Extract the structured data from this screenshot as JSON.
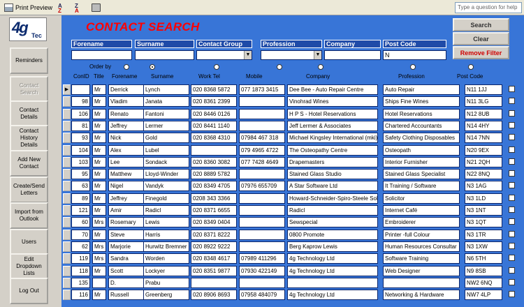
{
  "toolbar": {
    "print_preview": "Print Preview",
    "help_placeholder": "Type a question for help"
  },
  "logo": {
    "number": "4g",
    "text": "Tec"
  },
  "sidebar": [
    {
      "label": "Reminders",
      "disabled": false
    },
    {
      "label": "Contact Search",
      "disabled": true
    },
    {
      "label": "Contact Details",
      "disabled": false
    },
    {
      "label": "Contact History Details",
      "disabled": false
    },
    {
      "label": "Add New Contact",
      "disabled": false
    },
    {
      "label": "Create/Send Letters",
      "disabled": false
    },
    {
      "label": "Import from Outlook",
      "disabled": false
    },
    {
      "label": "Users",
      "disabled": false
    },
    {
      "label": "Edit Dropdown Lists",
      "disabled": false
    },
    {
      "label": "Log Out",
      "disabled": false
    }
  ],
  "title": "CONTACT SEARCH",
  "filters": {
    "forename": {
      "label": "Forename",
      "value": ""
    },
    "surname": {
      "label": "Surname",
      "value": ""
    },
    "contact_group": {
      "label": "Contact Group",
      "value": ""
    },
    "profession": {
      "label": "Profession",
      "value": ""
    },
    "company": {
      "label": "Company",
      "value": ""
    },
    "post_code": {
      "label": "Post Code",
      "value": "N"
    }
  },
  "actions": {
    "search": "Search",
    "clear": "Clear",
    "remove_filter": "Remove Filter"
  },
  "order_by": {
    "label": "Order by",
    "selected": "surname"
  },
  "columns": [
    "ConID",
    "Title",
    "Forename",
    "Surname",
    "Work Tel",
    "Mobile",
    "Company",
    "Profession",
    "Post Code"
  ],
  "colors": {
    "accent": "#3875d7",
    "title": "#ff0000",
    "label_bg": "#1f4ba8"
  },
  "rows": [
    {
      "id": "",
      "title": "Mr",
      "forename": "Derrick",
      "surname": "Lynch",
      "work": "020 8368 5872",
      "mobile": "077 1873 3415",
      "company": "Dee Bee - Auto Repair Centre",
      "profession": "Auto Repair",
      "post": "N11 1JJ"
    },
    {
      "id": "98",
      "title": "Mr",
      "forename": "Vladim",
      "surname": "Janata",
      "work": "020 8361 2399",
      "mobile": "",
      "company": "Vinohrad Wines",
      "profession": "Ships Fine Wines",
      "post": "N11 3LG"
    },
    {
      "id": "106",
      "title": "Mr",
      "forename": "Renato",
      "surname": "Fantoni",
      "work": "020 8446 0126",
      "mobile": "",
      "company": "H P S - Hotel Reservations",
      "profession": "Hotel Reservations",
      "post": "N12 8UB"
    },
    {
      "id": "81",
      "title": "Mr",
      "forename": "Jeffrey",
      "surname": "Lermer",
      "work": "020 8441 1140",
      "mobile": "",
      "company": "Jeff Lermer & Associates",
      "profession": "Chartered Accountants",
      "post": "N14 4HY"
    },
    {
      "id": "93",
      "title": "Mr",
      "forename": "Nick",
      "surname": "Gold",
      "work": "020 8368 4310",
      "mobile": "07984 467 318",
      "company": "Michael Kingsley International (mki)",
      "profession": "Safety Clothing Disposables",
      "post": "N14 7NN"
    },
    {
      "id": "104",
      "title": "Mr",
      "forename": "Alex",
      "surname": "Lubel",
      "work": "",
      "mobile": "079 4965 4722",
      "company": "The Osteopathy Centre",
      "profession": "Osteopath",
      "post": "N20 9EX"
    },
    {
      "id": "103",
      "title": "Mr",
      "forename": "Lee",
      "surname": "Sondack",
      "work": "020 8360 3082",
      "mobile": "077 7428 4649",
      "company": "Drapemasters",
      "profession": "Interior Furnisher",
      "post": "N21 2QH"
    },
    {
      "id": "95",
      "title": "Mr",
      "forename": "Matthew",
      "surname": "Lloyd-Winder",
      "work": "020 8889 5782",
      "mobile": "",
      "company": "Stained Glass Studio",
      "profession": "Stained Glass Specialist",
      "post": "N22 8NQ"
    },
    {
      "id": "63",
      "title": "Mr",
      "forename": "Nigel",
      "surname": "Vandyk",
      "work": "020 8349 4705",
      "mobile": "07976 655709",
      "company": "A Star Software Ltd",
      "profession": "It Training / Software",
      "post": "N3 1AG"
    },
    {
      "id": "89",
      "title": "Mr",
      "forename": "Jeffrey",
      "surname": "Finegold",
      "work": "0208 343 3366",
      "mobile": "",
      "company": "Howard-Schneider-Spiro-Steele Sol",
      "profession": "Solicitor",
      "post": "N3 1LD"
    },
    {
      "id": "121",
      "title": "Mr",
      "forename": "Amir",
      "surname": "Radicl",
      "work": "020 8371 6655",
      "mobile": "",
      "company": "Radicl",
      "profession": "Internet Café",
      "post": "N3 1NT"
    },
    {
      "id": "60",
      "title": "Mrs",
      "forename": "Rosemary",
      "surname": "Lewis",
      "work": "020 8349 0404",
      "mobile": "",
      "company": "Sewspecial",
      "profession": "Embroiderer",
      "post": "N3 1QT"
    },
    {
      "id": "70",
      "title": "Mr",
      "forename": "Steve",
      "surname": "Harris",
      "work": "020 8371 8222",
      "mobile": "",
      "company": "0800 Promote",
      "profession": "Printer -full Colour",
      "post": "N3 1TR"
    },
    {
      "id": "62",
      "title": "Mrs",
      "forename": "Marjorie",
      "surname": "Hurwitz Bremner",
      "work": "020 8922 9222",
      "mobile": "",
      "company": "Berg Kaprow Lewis",
      "profession": "Human Resources Consultar",
      "post": "N3 1XW"
    },
    {
      "id": "119",
      "title": "Mrs",
      "forename": "Sandra",
      "surname": "Worden",
      "work": "020 8348 4617",
      "mobile": "07989 411296",
      "company": "4g Technology Ltd",
      "profession": "Software Training",
      "post": "N6 5TH"
    },
    {
      "id": "118",
      "title": "Mr",
      "forename": "Scott",
      "surname": "Lockyer",
      "work": "020 8351 9877",
      "mobile": "07930 422149",
      "company": "4g Technology Ltd",
      "profession": "Web Designer",
      "post": "N9 8SB"
    },
    {
      "id": "135",
      "title": "",
      "forename": "D.",
      "surname": "Prabu",
      "work": "",
      "mobile": "",
      "company": "",
      "profession": "",
      "post": "NW2 6NQ"
    },
    {
      "id": "116",
      "title": "Mr",
      "forename": "Russell",
      "surname": "Greenberg",
      "work": "020 8906 8693",
      "mobile": "07958 484079",
      "company": "4g Technology Ltd",
      "profession": "Networking & Hardware",
      "post": "NW7 4LP"
    }
  ]
}
